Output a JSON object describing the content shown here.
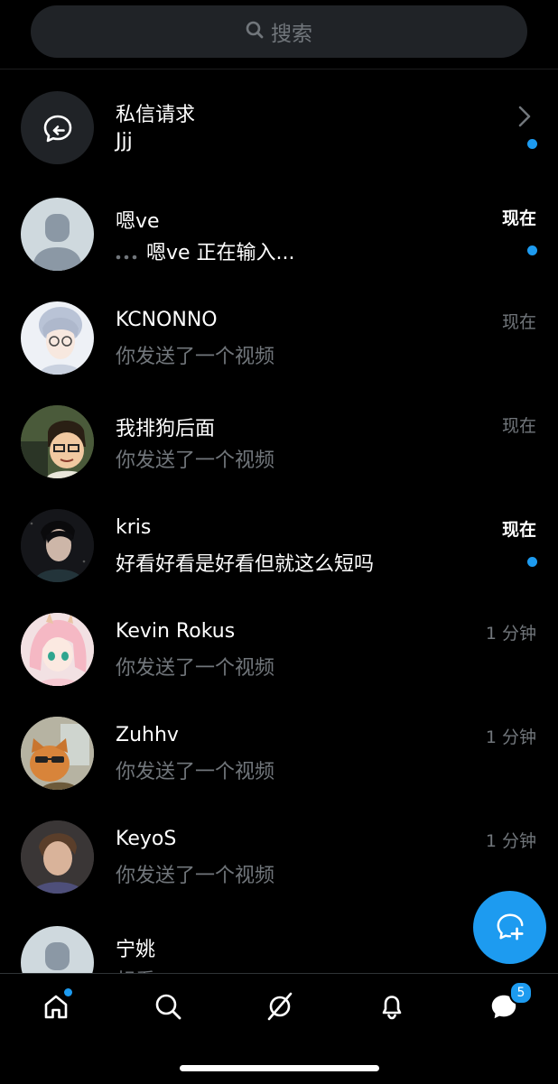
{
  "search": {
    "placeholder": "搜索"
  },
  "message_requests": {
    "title": "私信请求",
    "preview": "Jjj"
  },
  "conversations": [
    {
      "name": "嗯ve",
      "preview": "嗯ve 正在输入...",
      "time": "现在",
      "unread": true,
      "typing": true
    },
    {
      "name": "KCNONNO",
      "preview": "你发送了一个视频",
      "time": "现在",
      "unread": false
    },
    {
      "name": "我排狗后面",
      "preview": "你发送了一个视频",
      "time": "现在",
      "unread": false
    },
    {
      "name": "kris",
      "preview": "好看好看是好看但就这么短吗",
      "time": "现在",
      "unread": true
    },
    {
      "name": "Kevin Rokus",
      "preview": "你发送了一个视频",
      "time": "1 分钟",
      "unread": false
    },
    {
      "name": "Zuhhv",
      "preview": "你发送了一个视频",
      "time": "1 分钟",
      "unread": false
    },
    {
      "name": "KeyoS",
      "preview": "你发送了一个视频",
      "time": "1 分钟",
      "unread": false
    },
    {
      "name": "宁姚",
      "preview": "想看",
      "time": "",
      "unread": false
    }
  ],
  "bottom_nav": {
    "items": [
      "home-icon",
      "search-icon",
      "spaces-icon",
      "bell-icon",
      "messages-icon"
    ],
    "messages_badge": "5"
  },
  "colors": {
    "accent": "#1d9bf0",
    "background": "#000000",
    "muted_text": "#71767b"
  }
}
